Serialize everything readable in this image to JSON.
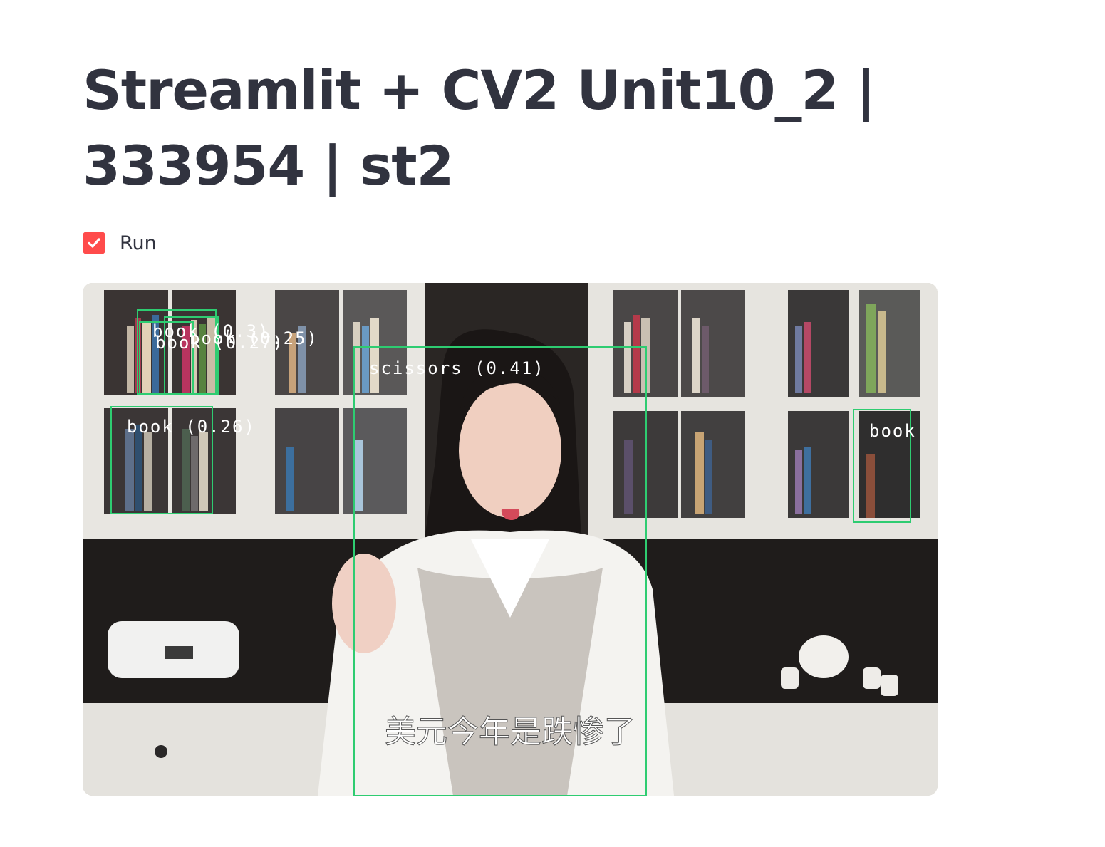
{
  "page": {
    "title": "Streamlit + CV2 Unit10_2 | 333954 | st2"
  },
  "controls": {
    "run_checkbox": {
      "label": "Run",
      "checked": true,
      "icon": "checkmark-icon",
      "color": "#ff4b4b"
    }
  },
  "video_frame": {
    "subtitle": "美元今年是跌惨了",
    "box_color": "#2ecc71",
    "detections": [
      {
        "label": "book (0.3)"
      },
      {
        "label": "book (0.27)"
      },
      {
        "label": "book (0.25)"
      },
      {
        "label": "book (0.26)"
      },
      {
        "label": "scissors (0.41)"
      },
      {
        "label": "book"
      }
    ]
  }
}
